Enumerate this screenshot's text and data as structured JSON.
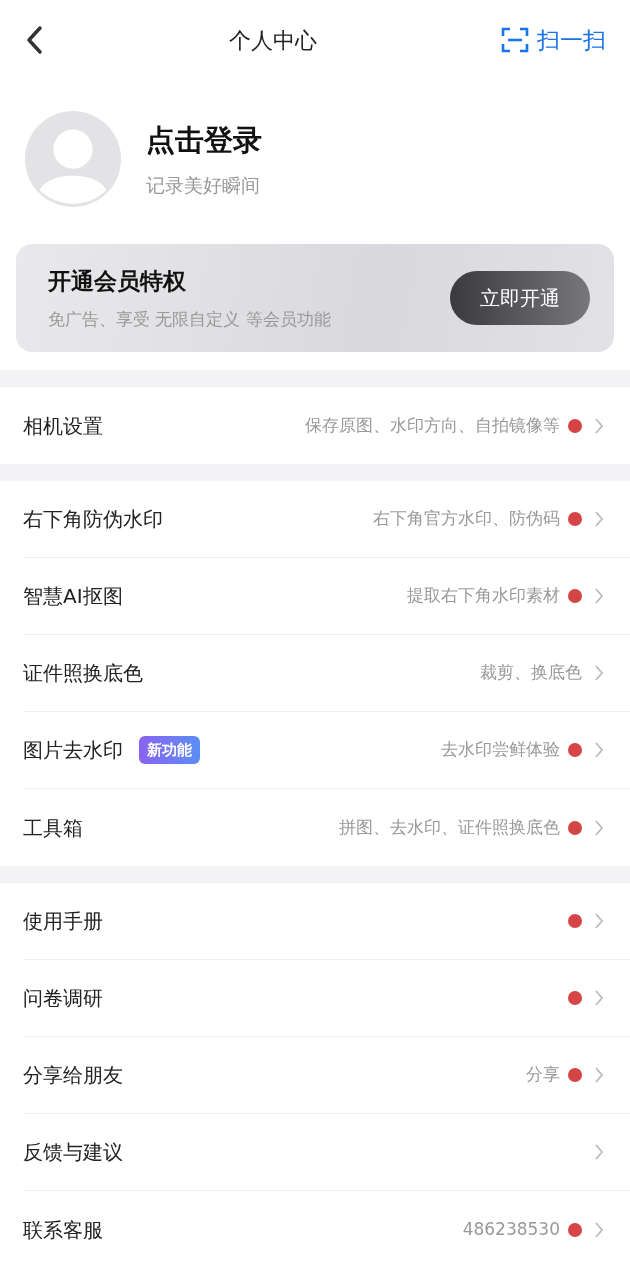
{
  "header": {
    "title": "个人中心",
    "scan_label": "扫一扫"
  },
  "profile": {
    "name": "点击登录",
    "subtitle": "记录美好瞬间"
  },
  "member_card": {
    "title": "开通会员特权",
    "subtitle": "免广告、享受 无限自定义 等会员功能",
    "button": "立即开通"
  },
  "sections": [
    {
      "rows": [
        {
          "label": "相机设置",
          "hint": "保存原图、水印方向、自拍镜像等",
          "dot": true
        }
      ]
    },
    {
      "rows": [
        {
          "label": "右下角防伪水印",
          "hint": "右下角官方水印、防伪码",
          "dot": true
        },
        {
          "label": "智慧AI抠图",
          "hint": "提取右下角水印素材",
          "dot": true
        },
        {
          "label": "证件照换底色",
          "hint": "裁剪、换底色",
          "dot": false
        },
        {
          "label": "图片去水印",
          "badge": "新功能",
          "hint": "去水印尝鲜体验",
          "dot": true
        },
        {
          "label": "工具箱",
          "hint": "拼图、去水印、证件照换底色",
          "dot": true
        }
      ]
    },
    {
      "rows": [
        {
          "label": "使用手册",
          "dot": true
        },
        {
          "label": "问卷调研",
          "dot": true
        },
        {
          "label": "分享给朋友",
          "hint": "分享",
          "dot": true
        },
        {
          "label": "反馈与建议",
          "dot": false
        },
        {
          "label": "联系客服",
          "hint": "486238530",
          "dot": true
        }
      ]
    }
  ]
}
